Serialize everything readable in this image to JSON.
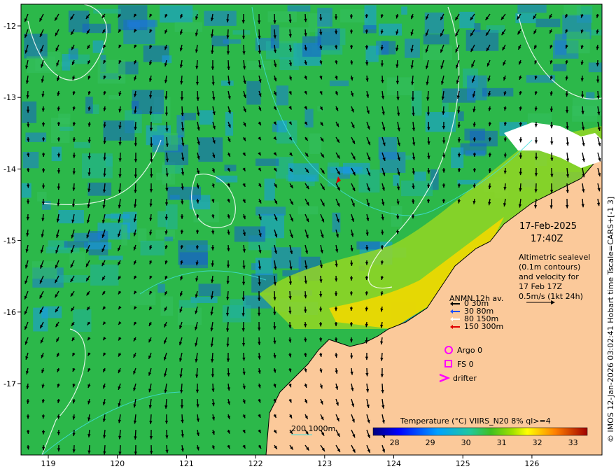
{
  "map": {
    "x_ticks": [
      "119",
      "120",
      "121",
      "122",
      "123",
      "124",
      "125",
      "126"
    ],
    "y_ticks": [
      "-12",
      "-13",
      "-14",
      "-15",
      "-16",
      "-17"
    ],
    "date": "17-Feb-2025",
    "time": "17:40Z",
    "description": [
      "Altimetric sealevel",
      "(0.1m contours)",
      "and velocity for",
      "17 Feb 17Z",
      "0.5m/s (1kt 24h)"
    ],
    "anmn": {
      "title": "ANMN 12h av.",
      "items": [
        {
          "label": "0 30m",
          "color": "#000000"
        },
        {
          "label": "30 80m",
          "color": "#1e50ff"
        },
        {
          "label": "80 150m",
          "color": "#ffffff"
        },
        {
          "label": "150 300m",
          "color": "#e00000"
        }
      ]
    },
    "markers": [
      {
        "label": "Argo 0",
        "symbol": "circle",
        "color": "#ff00ff"
      },
      {
        "label": "FS 0",
        "symbol": "square",
        "color": "#ff00ff"
      },
      {
        "label": "drifter",
        "symbol": "chevron",
        "color": "#ff00ff"
      }
    ],
    "depth_label": "200  1000m",
    "colorbar": {
      "title": "Temperature (°C) VIIRS_N20 8% ql>=4",
      "ticks": [
        "28",
        "29",
        "30",
        "31",
        "32",
        "33"
      ],
      "min": 27.4,
      "max": 33.4
    },
    "copyright": "© IMOS 12-Jan-2026 03:02:41 Hobart time Tscale=CARS+[-1 3]",
    "colors": {
      "land": "#fbc99a",
      "ocean_warm": "#f0d800",
      "ocean_mid": "#2cb84a",
      "ocean_cool": "#1e7ad8"
    }
  }
}
